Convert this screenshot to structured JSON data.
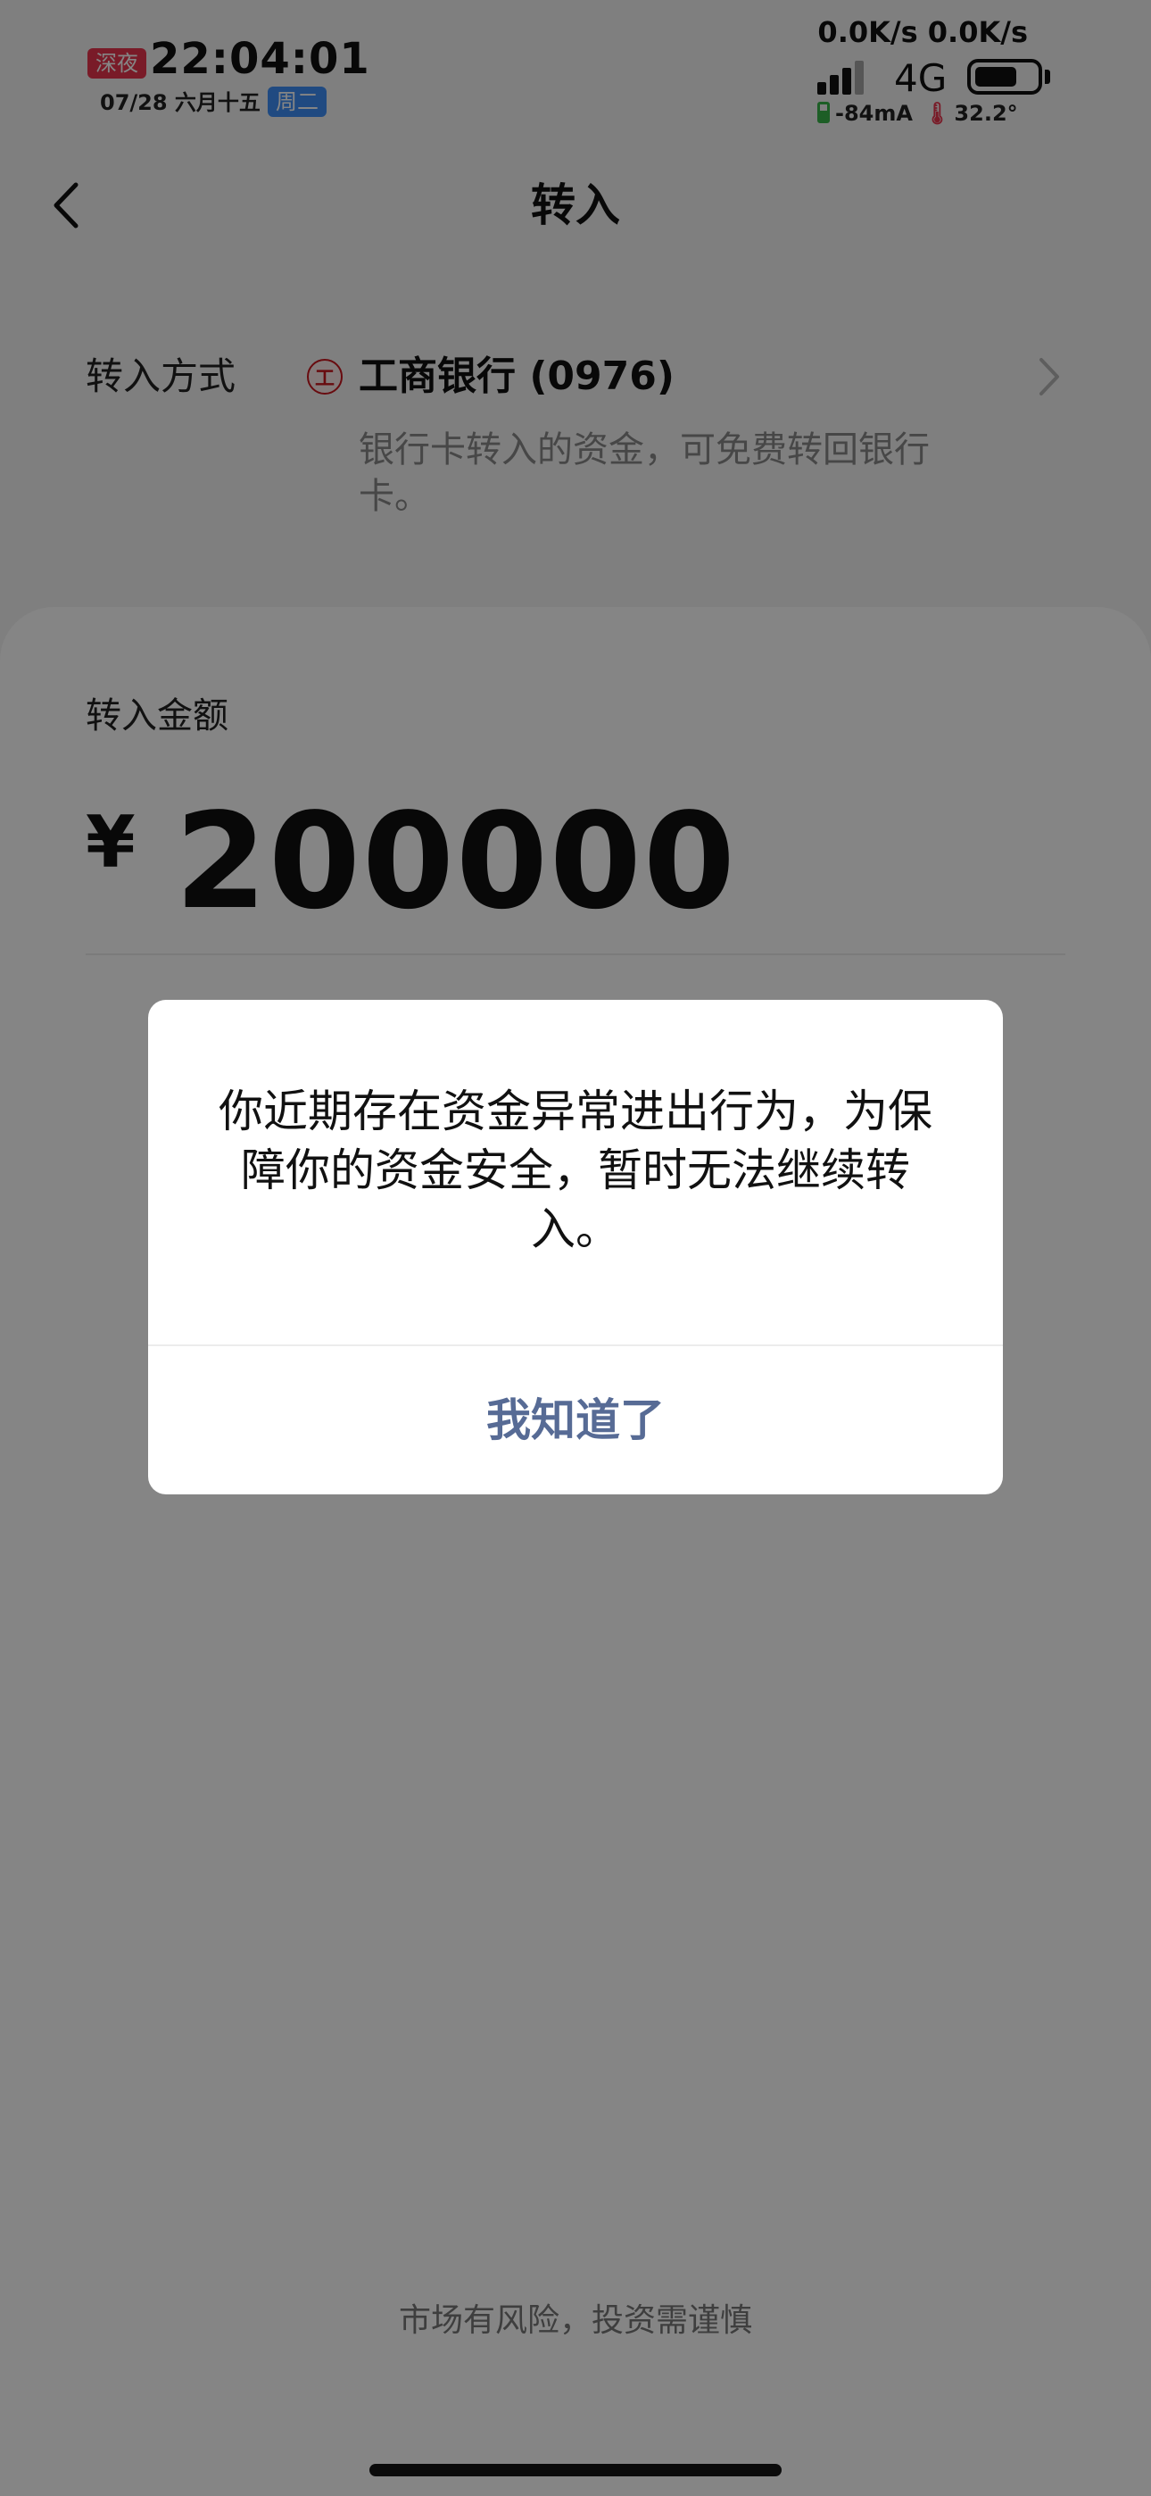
{
  "status_bar": {
    "night_badge": "深夜",
    "time": "22:04:01",
    "date": "07/28 六月十五",
    "weekday": "周二",
    "network_speed": "0.0K/s 0.0K/s",
    "network_type": "4G",
    "battery_level_percent": 70,
    "current": "-84mA",
    "temperature": "32.2°"
  },
  "nav": {
    "title": "转入"
  },
  "transfer_method": {
    "label": "转入方式",
    "bank_name": "工商银行 (0976)",
    "description": "银行卡转入的资金，可免费转回银行卡。"
  },
  "amount": {
    "label": "转入金额",
    "currency_symbol": "¥",
    "value": "200000"
  },
  "footer": {
    "risk_note": "市场有风险，投资需谨慎"
  },
  "dialog": {
    "message": "你近期存在资金异常进出行为，为保障你的资金安全，暂时无法继续转入。",
    "confirm_label": "我知道了"
  },
  "colors": {
    "night_badge": "#e8344e",
    "weekday_badge": "#3e8ef7",
    "dialog_button": "#576b95",
    "bank_brand": "#c7161e"
  },
  "icons": {
    "back": "chevron-left-icon",
    "method_arrow": "chevron-right-icon",
    "bank": "icbc-logo-icon",
    "signal": "signal-bars-icon",
    "battery": "battery-icon"
  }
}
